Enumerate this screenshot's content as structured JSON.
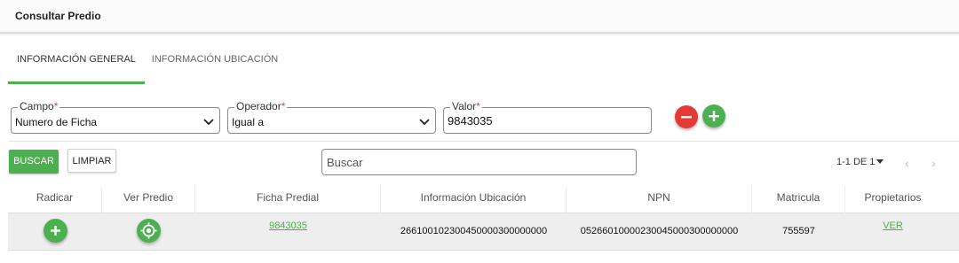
{
  "page": {
    "title": "Consultar Predio"
  },
  "tabs": [
    {
      "label": "INFORMACIÓN GENERAL",
      "active": true
    },
    {
      "label": "INFORMACIÓN UBICACIÓN",
      "active": false
    }
  ],
  "filters": {
    "campo": {
      "label": "Campo",
      "required_mark": "*",
      "value": "Numero de Ficha"
    },
    "operador": {
      "label": "Operador",
      "required_mark": "*",
      "value": "Igual a"
    },
    "valor": {
      "label": "Valor",
      "required_mark": "*",
      "value": "9843035"
    }
  },
  "actions": {
    "buscar": "BUSCAR",
    "limpiar": "LIMPIAR"
  },
  "search": {
    "placeholder": "Buscar"
  },
  "pagination": {
    "label": "1-1 DE 1"
  },
  "table": {
    "columns": [
      "Radicar",
      "Ver Predio",
      "Ficha Predial",
      "Información Ubicación",
      "NPN",
      "Matricula",
      "Propietarios"
    ],
    "rows": [
      {
        "ficha_predial": "9843035",
        "informacion_ubicacion": "266100102300450000300000000",
        "npn": "05266010000230045000300000000",
        "matricula": "755597",
        "propietarios": "VER"
      }
    ]
  },
  "colors": {
    "accent": "#4caf50",
    "danger": "#e53935"
  }
}
